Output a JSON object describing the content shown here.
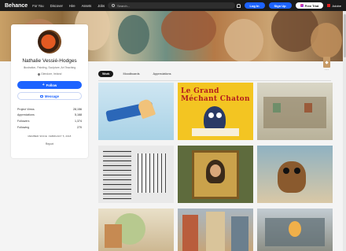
{
  "nav": {
    "brand": "Behance",
    "links": [
      "For You",
      "Discover",
      "Hire",
      "Assets",
      "Jobs"
    ],
    "search_placeholder": "Search...",
    "login": "Log In",
    "signup": "Sign Up",
    "free_trial": "Free Trial",
    "adobe": "Adobe"
  },
  "profile": {
    "name": "Nathalie Vessié-Hodges",
    "skills": "Illustration, Painting, Sculpture, Art Teaching",
    "location": "Glendore, Ireland",
    "follow": "Follow",
    "message": "Message",
    "stats": [
      {
        "label": "Project Views",
        "value": "28,156"
      },
      {
        "label": "Appreciations",
        "value": "5,168"
      },
      {
        "label": "Followers",
        "value": "1,374"
      },
      {
        "label": "Following",
        "value": "270"
      }
    ],
    "member_since": "MEMBER SINCE: FEBRUARY 5, 2018",
    "report": "Report"
  },
  "tabs": [
    "Work",
    "Moodboards",
    "Appreciations"
  ],
  "thumbnails": {
    "book_title": "Le Grand Méchant Chaton"
  },
  "colors": {
    "accent": "#1d63ff",
    "nav_bg": "#1b1b1b"
  }
}
